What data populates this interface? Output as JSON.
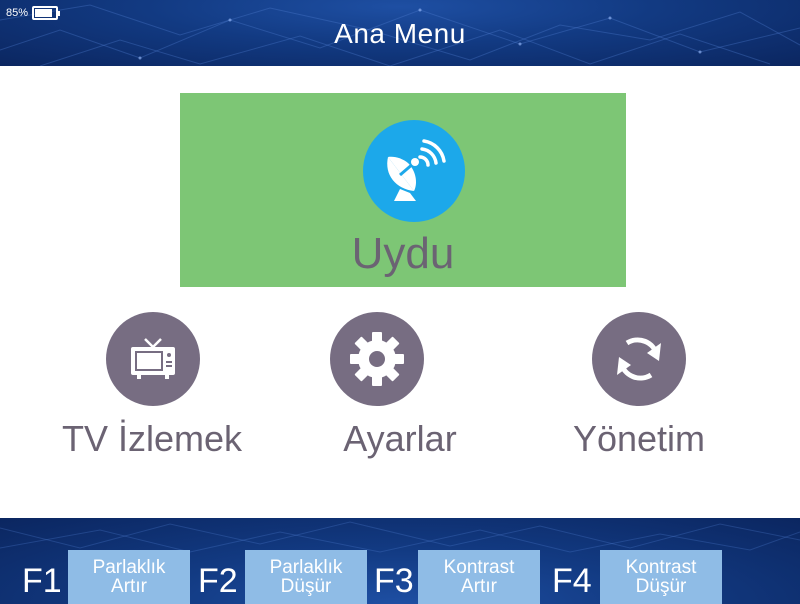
{
  "status": {
    "battery_percent": 85,
    "battery_text": "85%"
  },
  "header": {
    "title": "Ana Menu"
  },
  "featured": {
    "label": "Uydu",
    "icon": "satellite-dish-icon",
    "color": "#7dc675",
    "icon_bg": "#1ca8ea"
  },
  "menu": {
    "items": [
      {
        "label": "TV İzlemek",
        "icon": "tv-icon"
      },
      {
        "label": "Ayarlar",
        "icon": "gear-icon"
      },
      {
        "label": "Yönetim",
        "icon": "refresh-icon"
      }
    ],
    "icon_bg": "#776d82"
  },
  "function_keys": [
    {
      "key": "F1",
      "line1": "Parlaklık",
      "line2": "Artır"
    },
    {
      "key": "F2",
      "line1": "Parlaklık",
      "line2": "Düşür"
    },
    {
      "key": "F3",
      "line1": "Kontrast",
      "line2": "Artır"
    },
    {
      "key": "F4",
      "line1": "Kontrast",
      "line2": "Düşür"
    }
  ],
  "colors": {
    "header_bg": "#123a82",
    "fkey_button": "#8fbce6",
    "label_text": "#6b6373"
  }
}
